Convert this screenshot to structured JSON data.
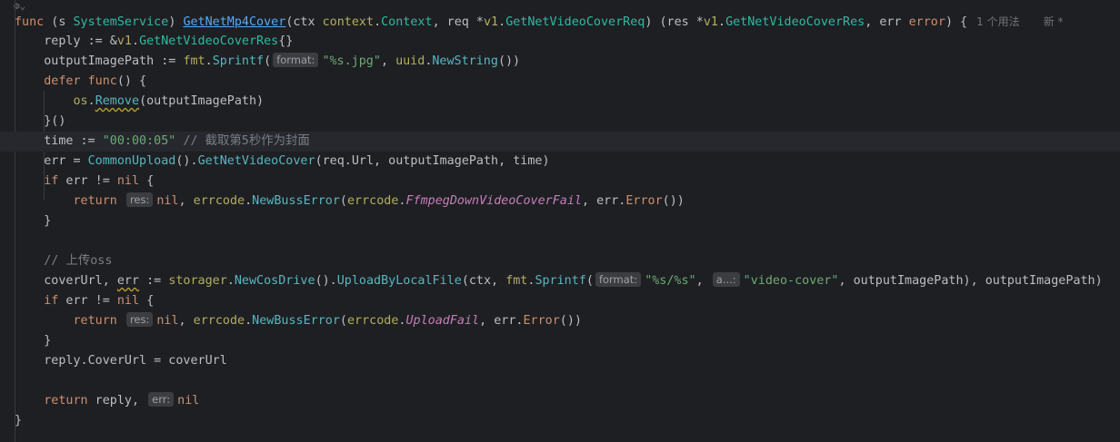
{
  "editor": {
    "usages_label": "1 个用法",
    "new_label": "新 *",
    "hint_format": "format:",
    "hint_res": "res:",
    "hint_err": "err:",
    "hint_a": "a...:",
    "comment_cover": "// 截取第5秒作为封面",
    "comment_upload": "// 上传oss"
  }
}
